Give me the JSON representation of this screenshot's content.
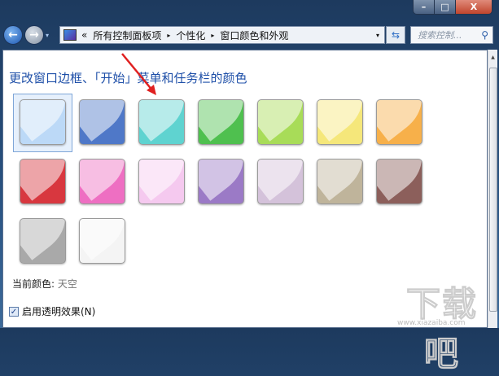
{
  "window": {
    "minimize": "–",
    "maximize": "□",
    "close": "X"
  },
  "address": {
    "prefix": "«",
    "crumbs": [
      "所有控制面板项",
      "个性化",
      "窗口颜色和外观"
    ],
    "separator": "▸",
    "dropdown": "▾"
  },
  "search": {
    "placeholder": "搜索控制...",
    "icon": "search-icon"
  },
  "heading": "更改窗口边框、「开始」菜单和任务栏的颜色",
  "swatches": [
    {
      "name": "sky",
      "color": "#bcd9f7",
      "selected": true
    },
    {
      "name": "blue",
      "color": "#4f78c8"
    },
    {
      "name": "teal",
      "color": "#5fd3d0"
    },
    {
      "name": "green",
      "color": "#4fc04f"
    },
    {
      "name": "lime",
      "color": "#a8dc58"
    },
    {
      "name": "yellow",
      "color": "#f5e77a"
    },
    {
      "name": "orange",
      "color": "#f7b04a"
    },
    {
      "name": "red",
      "color": "#d8373f"
    },
    {
      "name": "pink",
      "color": "#ee6fc2"
    },
    {
      "name": "light-pink",
      "color": "#f5c9ef"
    },
    {
      "name": "purple",
      "color": "#9b7ac6"
    },
    {
      "name": "lavender",
      "color": "#d4c2da"
    },
    {
      "name": "khaki",
      "color": "#bfb49b"
    },
    {
      "name": "brown",
      "color": "#8c5f5b"
    },
    {
      "name": "gray",
      "color": "#a9a9a9"
    },
    {
      "name": "white",
      "color": "#f4f4f4"
    }
  ],
  "current": {
    "label": "当前颜色:",
    "value": "天空"
  },
  "transparency": {
    "label": "启用透明效果(N)",
    "checked": true
  },
  "watermark": {
    "text": "下载吧",
    "url": "www.xiazaiba.com"
  }
}
